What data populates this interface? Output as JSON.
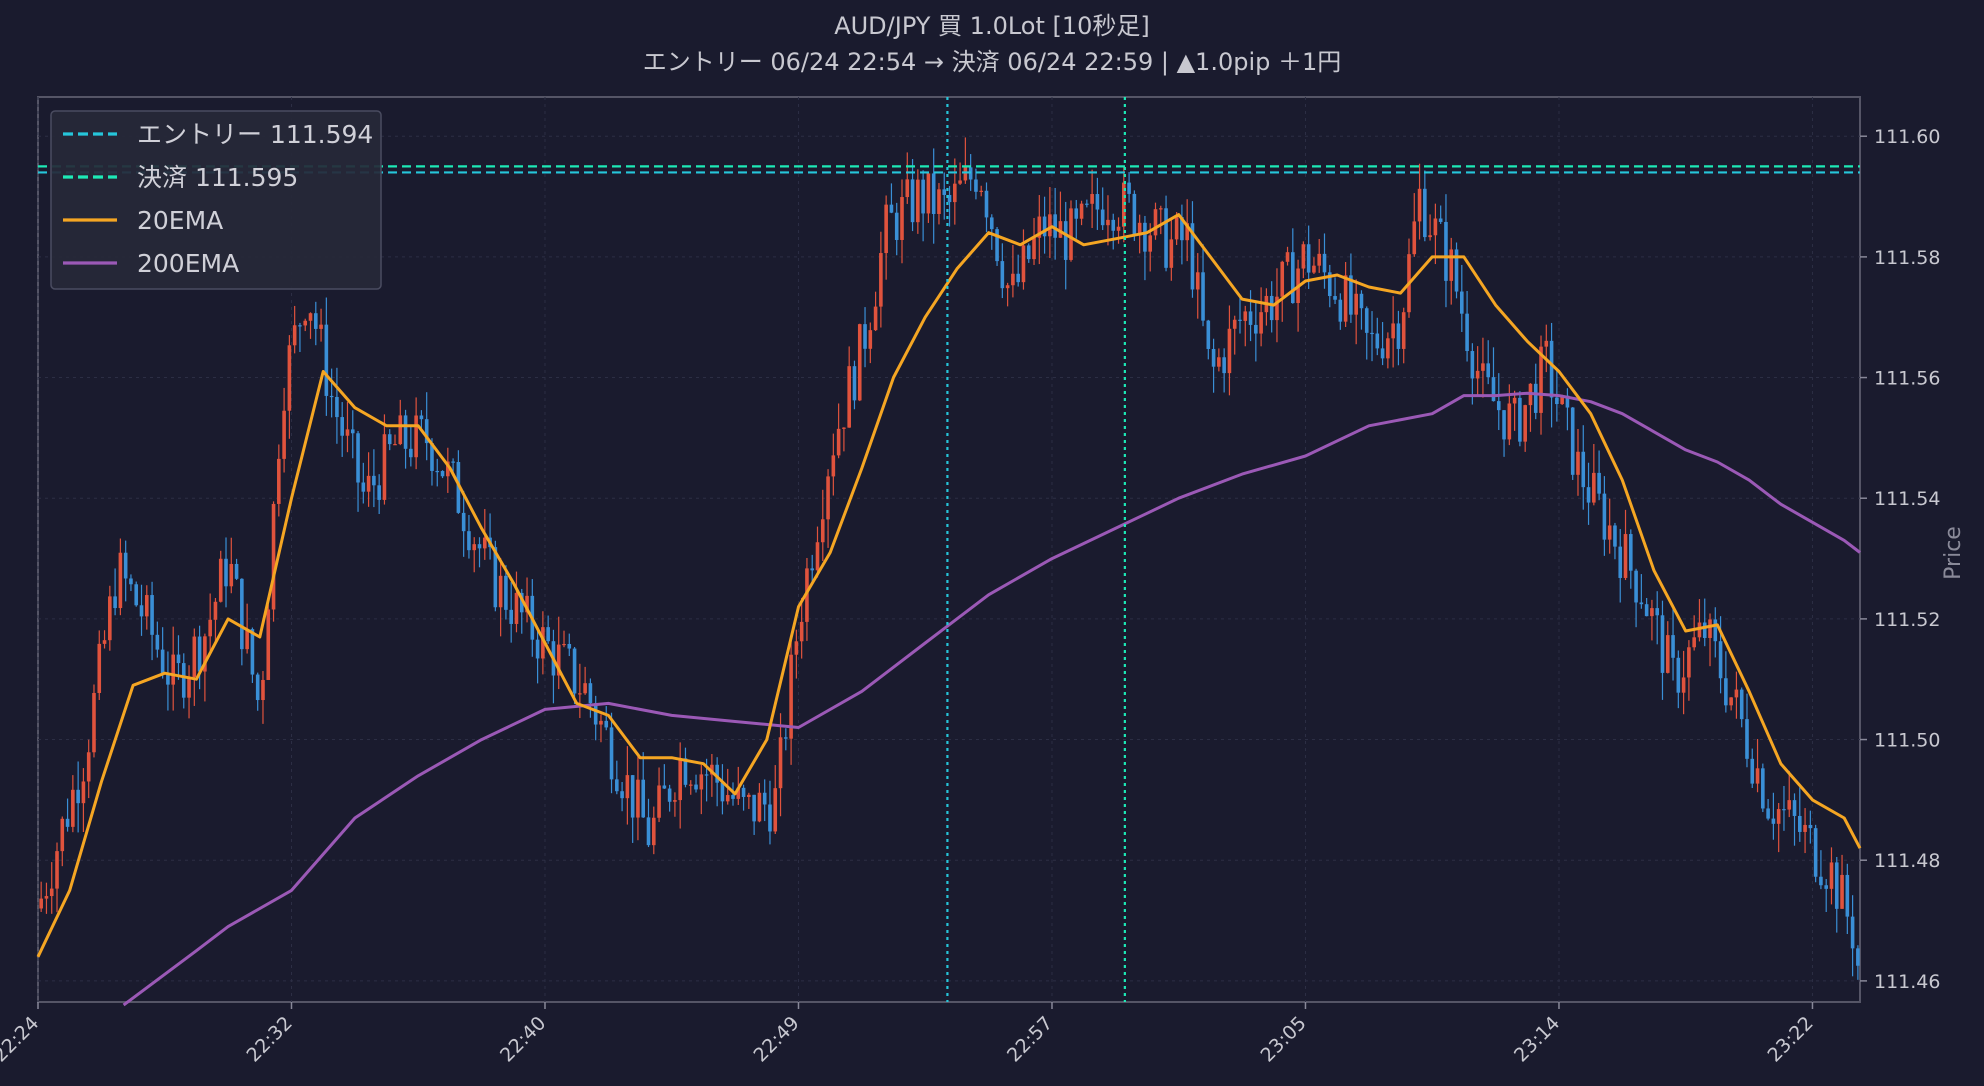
{
  "header": {
    "title_line1": "AUD/JPY  買  1.0Lot  [10秒足]",
    "title_line2": "エントリー 06/24 22:54  →  決済 06/24 22:59  |  ▲1.0pip  ＋1円"
  },
  "colors": {
    "background": "#1a1b2e",
    "up_candle": "#e0533d",
    "down_candle": "#3a8fd6",
    "entry_line": "#26c6da",
    "exit_line": "#1de9b6",
    "ema20": "#f5a623",
    "ema200": "#9b59b6",
    "text": "#c8c8d0"
  },
  "chart_data": {
    "type": "candlestick",
    "title": "AUD/JPY  買  1.0Lot  [10秒足]",
    "subtitle": "エントリー 06/24 22:54  →  決済 06/24 22:59  |  ▲1.0pip  ＋1円",
    "ylabel": "Price",
    "ylim": [
      111.4565,
      111.6065
    ],
    "yticks": [
      111.46,
      111.48,
      111.5,
      111.52,
      111.54,
      111.56,
      111.58,
      111.6
    ],
    "ytick_labels": [
      "111.46",
      "111.48",
      "111.50",
      "111.52",
      "111.54",
      "111.56",
      "111.58",
      "111.60"
    ],
    "xticks": [
      {
        "label": "22:24",
        "minute": 0
      },
      {
        "label": "22:32",
        "minute": 8
      },
      {
        "label": "22:40",
        "minute": 16
      },
      {
        "label": "22:49",
        "minute": 24
      },
      {
        "label": "22:57",
        "minute": 32
      },
      {
        "label": "23:05",
        "minute": 40
      },
      {
        "label": "23:14",
        "minute": 48
      },
      {
        "label": "23:22",
        "minute": 56
      }
    ],
    "xlim_minutes": [
      0,
      57.5
    ],
    "grid": true,
    "legend": {
      "position": "top-left",
      "entries": [
        {
          "label": "エントリー 111.594",
          "style": "dashed",
          "color": "#26c6da"
        },
        {
          "label": "決済 111.595",
          "style": "dashed",
          "color": "#1de9b6"
        },
        {
          "label": "20EMA",
          "style": "solid",
          "color": "#f5a623"
        },
        {
          "label": "200EMA",
          "style": "solid",
          "color": "#9b59b6"
        }
      ]
    },
    "hlines": [
      {
        "name": "entry",
        "value": 111.594
      },
      {
        "name": "exit",
        "value": 111.595
      }
    ],
    "vlines": [
      {
        "name": "entry-time",
        "minute": 28.7
      },
      {
        "name": "exit-time",
        "minute": 34.3
      }
    ],
    "price_path": [
      [
        0,
        111.472
      ],
      [
        1.5,
        111.498
      ],
      [
        2.5,
        111.528
      ],
      [
        3.3,
        111.521
      ],
      [
        4.3,
        111.509
      ],
      [
        5.3,
        111.518
      ],
      [
        6.0,
        111.53
      ],
      [
        7.0,
        111.505
      ],
      [
        7.7,
        111.558
      ],
      [
        8.5,
        111.575
      ],
      [
        9.3,
        111.556
      ],
      [
        10.3,
        111.54
      ],
      [
        11.3,
        111.549
      ],
      [
        12.3,
        111.55
      ],
      [
        13.3,
        111.54
      ],
      [
        14.3,
        111.527
      ],
      [
        15.3,
        111.52
      ],
      [
        16.3,
        111.514
      ],
      [
        17.3,
        111.508
      ],
      [
        18.3,
        111.496
      ],
      [
        19.3,
        111.484
      ],
      [
        20.3,
        111.497
      ],
      [
        21.3,
        111.494
      ],
      [
        22.3,
        111.488
      ],
      [
        23.3,
        111.49
      ],
      [
        24.0,
        111.52
      ],
      [
        25.0,
        111.548
      ],
      [
        26.0,
        111.565
      ],
      [
        26.8,
        111.585
      ],
      [
        27.8,
        111.59
      ],
      [
        28.7,
        111.588
      ],
      [
        29.7,
        111.595
      ],
      [
        30.7,
        111.573
      ],
      [
        31.7,
        111.585
      ],
      [
        32.7,
        111.583
      ],
      [
        33.7,
        111.59
      ],
      [
        34.7,
        111.587
      ],
      [
        35.7,
        111.582
      ],
      [
        36.3,
        111.583
      ],
      [
        37.0,
        111.56
      ],
      [
        38.0,
        111.57
      ],
      [
        39.0,
        111.573
      ],
      [
        40.0,
        111.58
      ],
      [
        41.0,
        111.575
      ],
      [
        42.0,
        111.565
      ],
      [
        43.0,
        111.57
      ],
      [
        43.6,
        111.59
      ],
      [
        44.6,
        111.578
      ],
      [
        45.6,
        111.558
      ],
      [
        46.6,
        111.552
      ],
      [
        47.6,
        111.562
      ],
      [
        48.6,
        111.545
      ],
      [
        49.6,
        111.535
      ],
      [
        50.6,
        111.525
      ],
      [
        51.6,
        111.51
      ],
      [
        52.6,
        111.518
      ],
      [
        53.6,
        111.505
      ],
      [
        54.6,
        111.49
      ],
      [
        55.6,
        111.485
      ],
      [
        56.6,
        111.478
      ],
      [
        57.3,
        111.468
      ],
      [
        57.5,
        111.46
      ]
    ],
    "ema20": [
      [
        0,
        111.464
      ],
      [
        1.0,
        111.475
      ],
      [
        2.0,
        111.493
      ],
      [
        3.0,
        111.509
      ],
      [
        4.0,
        111.511
      ],
      [
        5.0,
        111.51
      ],
      [
        6.0,
        111.52
      ],
      [
        7.0,
        111.517
      ],
      [
        8.0,
        111.54
      ],
      [
        9.0,
        111.561
      ],
      [
        10.0,
        111.555
      ],
      [
        11.0,
        111.552
      ],
      [
        12.0,
        111.552
      ],
      [
        13.0,
        111.545
      ],
      [
        14.0,
        111.535
      ],
      [
        15.0,
        111.526
      ],
      [
        16.0,
        111.516
      ],
      [
        17.0,
        111.506
      ],
      [
        18.0,
        111.504
      ],
      [
        19.0,
        111.497
      ],
      [
        20.0,
        111.497
      ],
      [
        21.0,
        111.496
      ],
      [
        22.0,
        111.491
      ],
      [
        23.0,
        111.5
      ],
      [
        24.0,
        111.522
      ],
      [
        25.0,
        111.531
      ],
      [
        26.0,
        111.545
      ],
      [
        27.0,
        111.56
      ],
      [
        28.0,
        111.57
      ],
      [
        29.0,
        111.578
      ],
      [
        30.0,
        111.584
      ],
      [
        31.0,
        111.582
      ],
      [
        32.0,
        111.585
      ],
      [
        33.0,
        111.582
      ],
      [
        34.0,
        111.583
      ],
      [
        35.0,
        111.584
      ],
      [
        36.0,
        111.587
      ],
      [
        37.0,
        111.58
      ],
      [
        38.0,
        111.573
      ],
      [
        39.0,
        111.572
      ],
      [
        40.0,
        111.576
      ],
      [
        41.0,
        111.577
      ],
      [
        42.0,
        111.575
      ],
      [
        43.0,
        111.574
      ],
      [
        44.0,
        111.58
      ],
      [
        45.0,
        111.58
      ],
      [
        46.0,
        111.572
      ],
      [
        47.0,
        111.566
      ],
      [
        48.0,
        111.561
      ],
      [
        49.0,
        111.554
      ],
      [
        50.0,
        111.543
      ],
      [
        51.0,
        111.528
      ],
      [
        52.0,
        111.518
      ],
      [
        53.0,
        111.519
      ],
      [
        54.0,
        111.508
      ],
      [
        55.0,
        111.496
      ],
      [
        56.0,
        111.49
      ],
      [
        57.0,
        111.487
      ],
      [
        57.5,
        111.482
      ]
    ],
    "ema200": [
      [
        2.7,
        111.456
      ],
      [
        5.0,
        111.465
      ],
      [
        6.0,
        111.469
      ],
      [
        8.0,
        111.475
      ],
      [
        10.0,
        111.487
      ],
      [
        12.0,
        111.494
      ],
      [
        14.0,
        111.5
      ],
      [
        16.0,
        111.505
      ],
      [
        18.0,
        111.506
      ],
      [
        20.0,
        111.504
      ],
      [
        22.0,
        111.503
      ],
      [
        24.0,
        111.502
      ],
      [
        26.0,
        111.508
      ],
      [
        28.0,
        111.516
      ],
      [
        30.0,
        111.524
      ],
      [
        32.0,
        111.53
      ],
      [
        34.0,
        111.535
      ],
      [
        36.0,
        111.54
      ],
      [
        38.0,
        111.544
      ],
      [
        40.0,
        111.547
      ],
      [
        42.0,
        111.552
      ],
      [
        44.0,
        111.554
      ],
      [
        45.0,
        111.557
      ],
      [
        46.0,
        111.557
      ],
      [
        47.0,
        111.5574
      ],
      [
        48.0,
        111.557
      ],
      [
        49.0,
        111.556
      ],
      [
        50.0,
        111.554
      ],
      [
        51.0,
        111.551
      ],
      [
        52.0,
        111.548
      ],
      [
        53.0,
        111.546
      ],
      [
        54.0,
        111.543
      ],
      [
        55.0,
        111.539
      ],
      [
        56.0,
        111.536
      ],
      [
        57.0,
        111.533
      ],
      [
        57.5,
        111.531
      ]
    ]
  }
}
